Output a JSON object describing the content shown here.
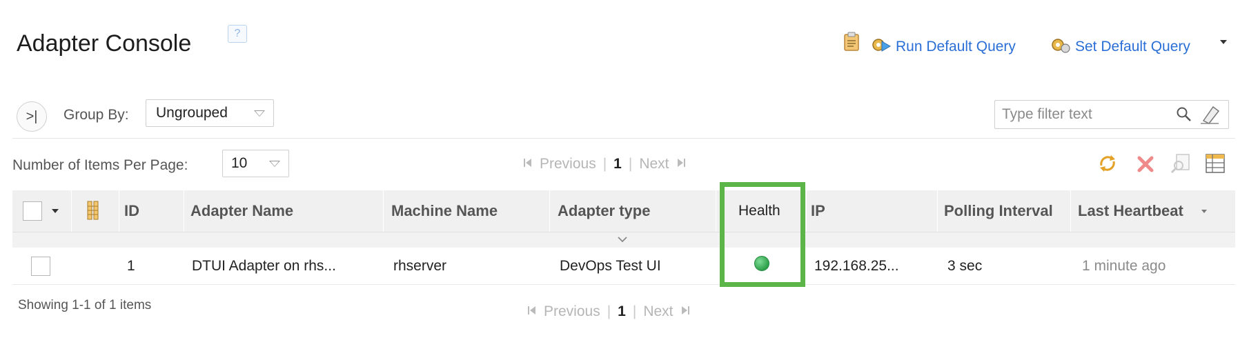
{
  "header": {
    "title": "Adapter Console",
    "help_label": "?",
    "run_default_query": "Run Default Query",
    "set_default_query": "Set Default Query"
  },
  "toolbar": {
    "group_by_label": "Group By:",
    "group_by_value": "Ungrouped",
    "filter_placeholder": "Type filter text",
    "items_per_page_label": "Number of Items Per Page:",
    "items_per_page_value": "10"
  },
  "pagination": {
    "previous": "Previous",
    "current_page": "1",
    "next": "Next",
    "separator": "|"
  },
  "table": {
    "columns": {
      "id": "ID",
      "adapter_name": "Adapter Name",
      "machine_name": "Machine Name",
      "adapter_type": "Adapter type",
      "health": "Health",
      "ip": "IP",
      "polling_interval": "Polling Interval",
      "last_heartbeat": "Last Heartbeat"
    },
    "rows": [
      {
        "id": "1",
        "adapter_name": "DTUI Adapter on rhs...",
        "machine_name": "rhserver",
        "adapter_type": "DevOps Test UI",
        "health": "healthy",
        "ip": "192.168.25...",
        "polling_interval": "3 sec",
        "last_heartbeat": "1 minute ago"
      }
    ]
  },
  "footer": {
    "showing": "Showing 1-1 of 1 items"
  },
  "colors": {
    "link": "#2a6fd6",
    "health_ok": "#2ea04a",
    "highlight": "#5cb548"
  }
}
